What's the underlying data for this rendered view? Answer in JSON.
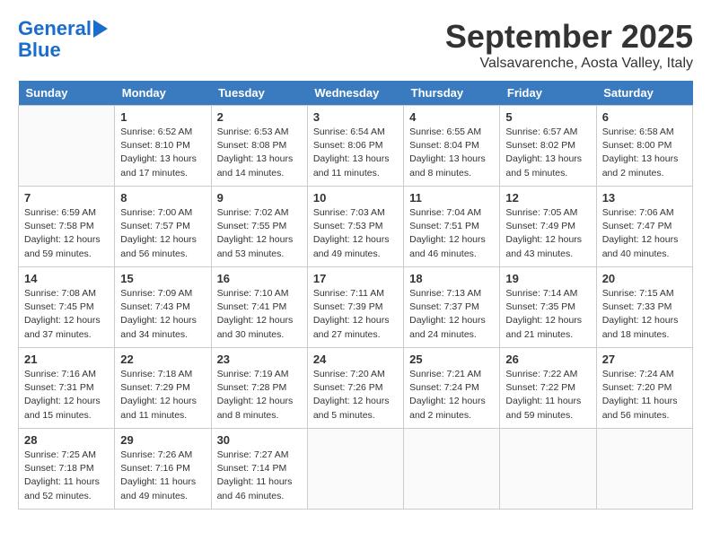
{
  "header": {
    "logo_line1": "General",
    "logo_line2": "Blue",
    "month": "September 2025",
    "location": "Valsavarenche, Aosta Valley, Italy"
  },
  "weekdays": [
    "Sunday",
    "Monday",
    "Tuesday",
    "Wednesday",
    "Thursday",
    "Friday",
    "Saturday"
  ],
  "weeks": [
    [
      {
        "day": "",
        "text": ""
      },
      {
        "day": "1",
        "text": "Sunrise: 6:52 AM\nSunset: 8:10 PM\nDaylight: 13 hours\nand 17 minutes."
      },
      {
        "day": "2",
        "text": "Sunrise: 6:53 AM\nSunset: 8:08 PM\nDaylight: 13 hours\nand 14 minutes."
      },
      {
        "day": "3",
        "text": "Sunrise: 6:54 AM\nSunset: 8:06 PM\nDaylight: 13 hours\nand 11 minutes."
      },
      {
        "day": "4",
        "text": "Sunrise: 6:55 AM\nSunset: 8:04 PM\nDaylight: 13 hours\nand 8 minutes."
      },
      {
        "day": "5",
        "text": "Sunrise: 6:57 AM\nSunset: 8:02 PM\nDaylight: 13 hours\nand 5 minutes."
      },
      {
        "day": "6",
        "text": "Sunrise: 6:58 AM\nSunset: 8:00 PM\nDaylight: 13 hours\nand 2 minutes."
      }
    ],
    [
      {
        "day": "7",
        "text": "Sunrise: 6:59 AM\nSunset: 7:58 PM\nDaylight: 12 hours\nand 59 minutes."
      },
      {
        "day": "8",
        "text": "Sunrise: 7:00 AM\nSunset: 7:57 PM\nDaylight: 12 hours\nand 56 minutes."
      },
      {
        "day": "9",
        "text": "Sunrise: 7:02 AM\nSunset: 7:55 PM\nDaylight: 12 hours\nand 53 minutes."
      },
      {
        "day": "10",
        "text": "Sunrise: 7:03 AM\nSunset: 7:53 PM\nDaylight: 12 hours\nand 49 minutes."
      },
      {
        "day": "11",
        "text": "Sunrise: 7:04 AM\nSunset: 7:51 PM\nDaylight: 12 hours\nand 46 minutes."
      },
      {
        "day": "12",
        "text": "Sunrise: 7:05 AM\nSunset: 7:49 PM\nDaylight: 12 hours\nand 43 minutes."
      },
      {
        "day": "13",
        "text": "Sunrise: 7:06 AM\nSunset: 7:47 PM\nDaylight: 12 hours\nand 40 minutes."
      }
    ],
    [
      {
        "day": "14",
        "text": "Sunrise: 7:08 AM\nSunset: 7:45 PM\nDaylight: 12 hours\nand 37 minutes."
      },
      {
        "day": "15",
        "text": "Sunrise: 7:09 AM\nSunset: 7:43 PM\nDaylight: 12 hours\nand 34 minutes."
      },
      {
        "day": "16",
        "text": "Sunrise: 7:10 AM\nSunset: 7:41 PM\nDaylight: 12 hours\nand 30 minutes."
      },
      {
        "day": "17",
        "text": "Sunrise: 7:11 AM\nSunset: 7:39 PM\nDaylight: 12 hours\nand 27 minutes."
      },
      {
        "day": "18",
        "text": "Sunrise: 7:13 AM\nSunset: 7:37 PM\nDaylight: 12 hours\nand 24 minutes."
      },
      {
        "day": "19",
        "text": "Sunrise: 7:14 AM\nSunset: 7:35 PM\nDaylight: 12 hours\nand 21 minutes."
      },
      {
        "day": "20",
        "text": "Sunrise: 7:15 AM\nSunset: 7:33 PM\nDaylight: 12 hours\nand 18 minutes."
      }
    ],
    [
      {
        "day": "21",
        "text": "Sunrise: 7:16 AM\nSunset: 7:31 PM\nDaylight: 12 hours\nand 15 minutes."
      },
      {
        "day": "22",
        "text": "Sunrise: 7:18 AM\nSunset: 7:29 PM\nDaylight: 12 hours\nand 11 minutes."
      },
      {
        "day": "23",
        "text": "Sunrise: 7:19 AM\nSunset: 7:28 PM\nDaylight: 12 hours\nand 8 minutes."
      },
      {
        "day": "24",
        "text": "Sunrise: 7:20 AM\nSunset: 7:26 PM\nDaylight: 12 hours\nand 5 minutes."
      },
      {
        "day": "25",
        "text": "Sunrise: 7:21 AM\nSunset: 7:24 PM\nDaylight: 12 hours\nand 2 minutes."
      },
      {
        "day": "26",
        "text": "Sunrise: 7:22 AM\nSunset: 7:22 PM\nDaylight: 11 hours\nand 59 minutes."
      },
      {
        "day": "27",
        "text": "Sunrise: 7:24 AM\nSunset: 7:20 PM\nDaylight: 11 hours\nand 56 minutes."
      }
    ],
    [
      {
        "day": "28",
        "text": "Sunrise: 7:25 AM\nSunset: 7:18 PM\nDaylight: 11 hours\nand 52 minutes."
      },
      {
        "day": "29",
        "text": "Sunrise: 7:26 AM\nSunset: 7:16 PM\nDaylight: 11 hours\nand 49 minutes."
      },
      {
        "day": "30",
        "text": "Sunrise: 7:27 AM\nSunset: 7:14 PM\nDaylight: 11 hours\nand 46 minutes."
      },
      {
        "day": "",
        "text": ""
      },
      {
        "day": "",
        "text": ""
      },
      {
        "day": "",
        "text": ""
      },
      {
        "day": "",
        "text": ""
      }
    ]
  ]
}
